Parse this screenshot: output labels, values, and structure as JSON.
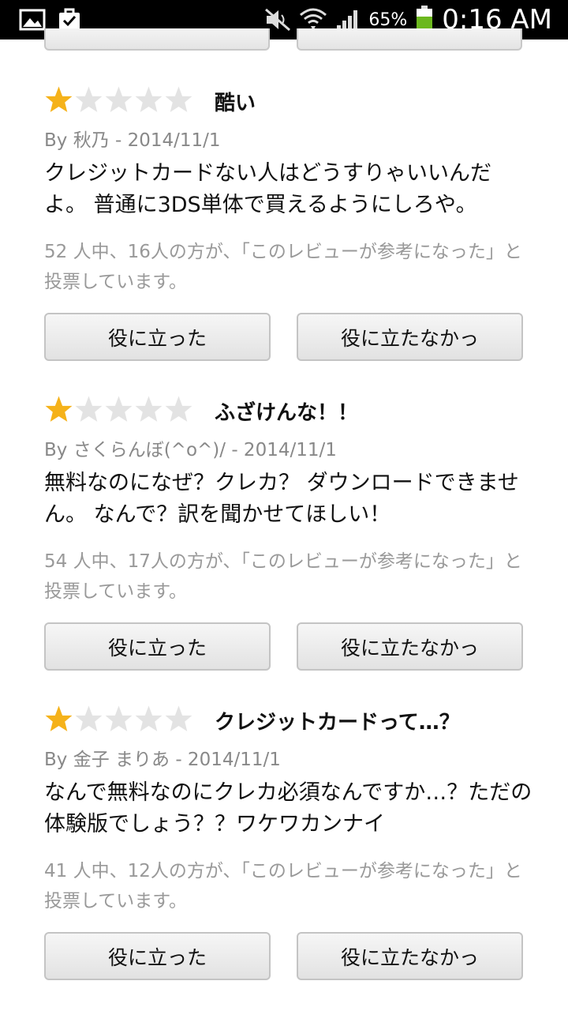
{
  "status_bar": {
    "battery_percent": "65%",
    "time": "0:16 AM"
  },
  "reviews": [
    {
      "rating": 1,
      "title": "酷い",
      "byline": "By 秋乃 - 2014/11/1",
      "body": "クレジットカードない人はどうすりゃいいんだよ。 普通に3DS単体で買えるようにしろや。",
      "helpful": "52 人中、16人の方が、「このレビューが参考になった」と投票しています。",
      "helpful_label": "役に立った",
      "unhelpful_label": "役に立たなかっ"
    },
    {
      "rating": 1,
      "title": "ふざけんな！！",
      "byline": "By さくらんぼ(^o^)/ - 2014/11/1",
      "body": "無料なのになぜ？クレカ？ ダウンロードできません。 なんで？訳を聞かせてほしい！",
      "helpful": "54 人中、17人の方が、「このレビューが参考になった」と投票しています。",
      "helpful_label": "役に立った",
      "unhelpful_label": "役に立たなかっ"
    },
    {
      "rating": 1,
      "title": "クレジットカードって…？",
      "byline": "By 金子 まりあ - 2014/11/1",
      "body": "なんで無料なのにクレカ必須なんですか…？ただの体験版でしょう？？ワケワカンナイ",
      "helpful": "41 人中、12人の方が、「このレビューが参考になった」と投票しています。",
      "helpful_label": "役に立った",
      "unhelpful_label": "役に立たなかっ"
    }
  ],
  "colors": {
    "star_filled": "#f5b21a",
    "star_empty": "#e0e0e0",
    "battery": "#6cb81e"
  }
}
